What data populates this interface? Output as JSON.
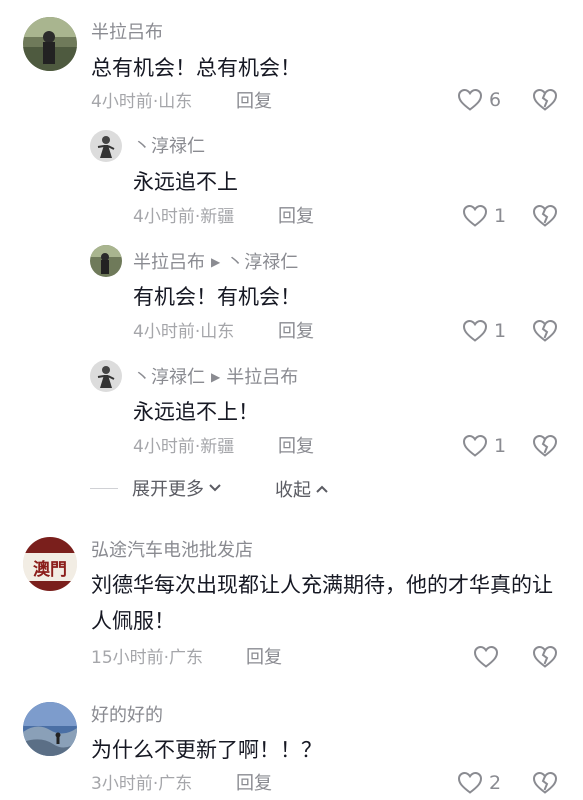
{
  "comments": [
    {
      "username": "半拉吕布",
      "text": "总有机会！总有机会！",
      "meta": "4小时前·山东",
      "reply": "回复",
      "likes": "6",
      "replies": [
        {
          "username": "丶淳禄仁",
          "reply_to": "",
          "text": "永远追不上",
          "meta": "4小时前·新疆",
          "reply": "回复",
          "likes": "1"
        },
        {
          "username": "半拉吕布",
          "reply_to": "丶淳禄仁",
          "text": "有机会！有机会！",
          "meta": "4小时前·山东",
          "reply": "回复",
          "likes": "1"
        },
        {
          "username": "丶淳禄仁",
          "reply_to": "半拉吕布",
          "text": "永远追不上！",
          "meta": "4小时前·新疆",
          "reply": "回复",
          "likes": "1"
        }
      ],
      "expand_label": "展开更多",
      "collapse_label": "收起"
    },
    {
      "username": "弘途汽车电池批发店",
      "avatar_text": "澳門",
      "text": "刘德华每次出现都让人充满期待，他的才华真的让人佩服！",
      "meta": "15小时前·广东",
      "reply": "回复",
      "likes": ""
    },
    {
      "username": "好的好的",
      "text": "为什么不更新了啊！！？",
      "meta": "3小时前·广东",
      "reply": "回复",
      "likes": "2"
    }
  ],
  "colors": {
    "text": "#161823",
    "secondary": "#8a8b91",
    "meta": "#a5a6aa"
  }
}
